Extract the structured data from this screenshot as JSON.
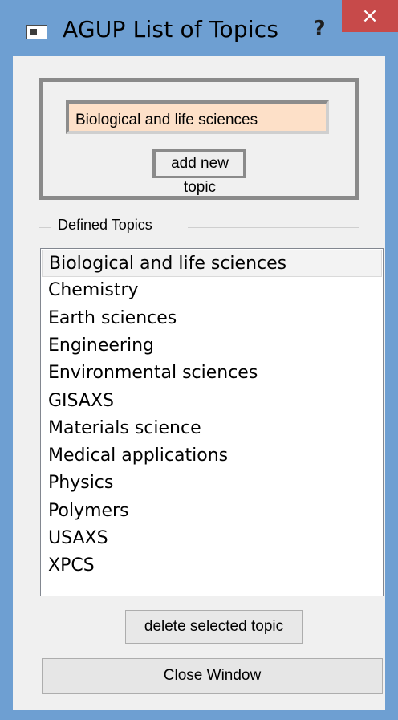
{
  "window": {
    "title": "AGUP List of Topics",
    "help_label": "?",
    "close_label": "×"
  },
  "new_topic": {
    "input_value": "Biological and life sciences",
    "add_button_label": "add new topic"
  },
  "defined_topics": {
    "group_label": "Defined Topics",
    "selected_index": 0,
    "items": [
      {
        "label": "Biological and life sciences"
      },
      {
        "label": "Chemistry"
      },
      {
        "label": "Earth sciences"
      },
      {
        "label": "Engineering"
      },
      {
        "label": "Environmental sciences"
      },
      {
        "label": "GISAXS"
      },
      {
        "label": "Materials science"
      },
      {
        "label": "Medical applications"
      },
      {
        "label": "Physics"
      },
      {
        "label": "Polymers"
      },
      {
        "label": "USAXS"
      },
      {
        "label": "XPCS"
      }
    ]
  },
  "buttons": {
    "delete_label": "delete selected topic",
    "close_window_label": "Close Window"
  }
}
